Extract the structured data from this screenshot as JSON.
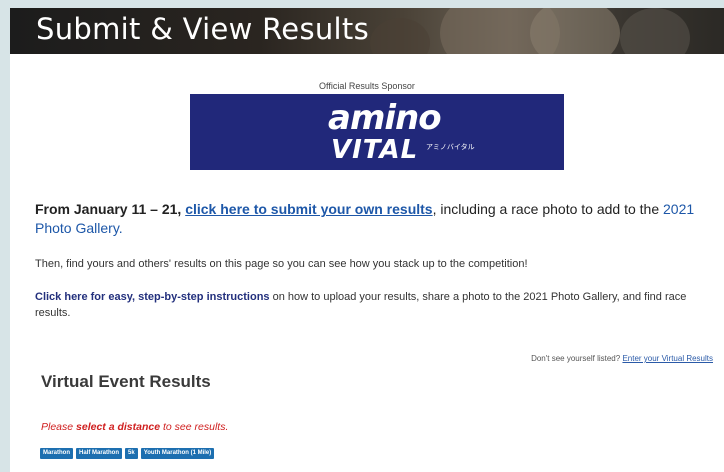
{
  "banner": {
    "title": "Submit & View Results"
  },
  "sponsor": {
    "label": "Official Results Sponsor",
    "logo_line1": "amino",
    "logo_line2": "VITAL",
    "logo_jp": "アミノバイタル",
    "logo_color": "#21287a"
  },
  "intro": {
    "date_range": "From January 11 – 21,",
    "submit_link": "click here to submit your own results",
    "mid_text": ", including a race photo to add to the",
    "gallery_link": "2021 Photo Gallery."
  },
  "then_text": "Then, find yours and others' results on this page so you can see how you stack up to the competition!",
  "instructions": {
    "link": "Click here for easy, step-by-step instructions",
    "rest": " on how to upload your results, share a photo to the 2021 Photo Gallery, and find race results."
  },
  "dont_see": {
    "text": "Don't see yourself listed?",
    "link": "Enter your Virtual Results"
  },
  "results": {
    "heading": "Virtual Event Results",
    "prompt_pre": "Please ",
    "prompt_bold": "select a distance",
    "prompt_post": " to see results.",
    "distances": [
      "Marathon",
      "Half Marathon",
      "5k",
      "Youth Marathon (1 Mile)"
    ]
  }
}
